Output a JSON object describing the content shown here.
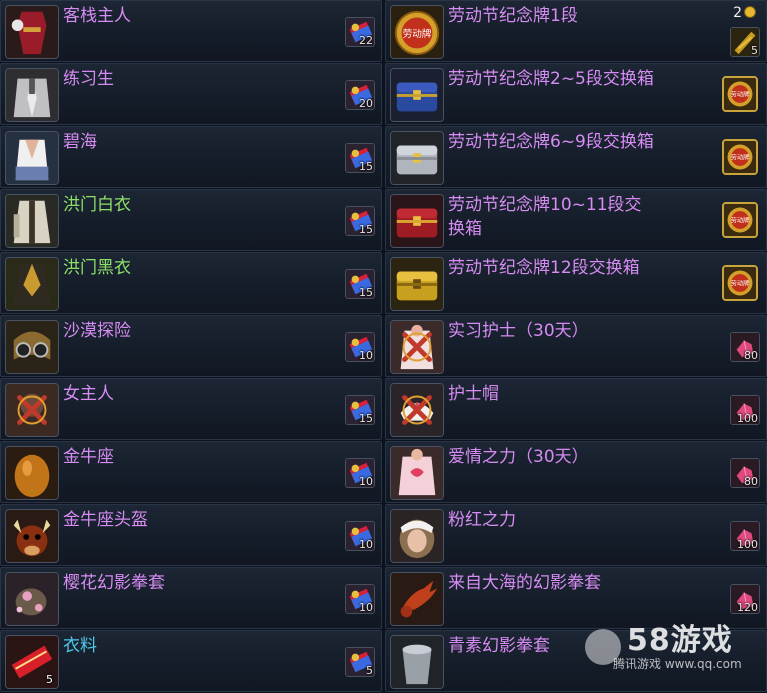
{
  "left_items": [
    {
      "name": "客栈主人",
      "price": "22",
      "name_color": "purple",
      "icon": "dress-icon"
    },
    {
      "name": "练习生",
      "price": "20",
      "name_color": "purple",
      "icon": "suit-icon"
    },
    {
      "name": "碧海",
      "price": "15",
      "name_color": "purple",
      "icon": "vest-icon"
    },
    {
      "name": "洪门白衣",
      "price": "15",
      "name_color": "green",
      "icon": "robe-icon"
    },
    {
      "name": "洪门黑衣",
      "price": "15",
      "name_color": "green",
      "icon": "robe-dark-icon"
    },
    {
      "name": "沙漠探险",
      "price": "10",
      "name_color": "purple",
      "icon": "goggles-icon"
    },
    {
      "name": "女主人",
      "price": "15",
      "name_color": "purple",
      "icon": "hidden-x-icon"
    },
    {
      "name": "金牛座",
      "price": "10",
      "name_color": "purple",
      "icon": "egg-icon"
    },
    {
      "name": "金牛座头盔",
      "price": "10",
      "name_color": "purple",
      "icon": "bull-helmet-icon"
    },
    {
      "name": "樱花幻影拳套",
      "price": "10",
      "name_color": "purple",
      "icon": "flower-glove-icon"
    },
    {
      "name": "衣料",
      "price": "5",
      "name_color": "cyan",
      "icon": "fabric-icon",
      "quantity": "5"
    }
  ],
  "right_items": [
    {
      "name": "劳动节纪念牌1段",
      "icon": "medal-icon",
      "icon_text": "劳动牌",
      "price_type": "corner",
      "count": "2",
      "price": "5"
    },
    {
      "name": "劳动节纪念牌2~5段交换箱",
      "icon": "chest-blue-icon",
      "price_type": "medal"
    },
    {
      "name": "劳动节纪念牌6~9段交换箱",
      "icon": "chest-silver-icon",
      "price_type": "medal"
    },
    {
      "name": "劳动节纪念牌10~11段交换箱",
      "icon": "chest-red-icon",
      "price_type": "medal"
    },
    {
      "name": "劳动节纪念牌12段交换箱",
      "icon": "chest-gold-icon",
      "price_type": "medal"
    },
    {
      "name": "实习护士（30天）",
      "icon": "nurse-x-icon",
      "price_type": "crystal",
      "price": "80"
    },
    {
      "name": "护士帽",
      "icon": "nurse-cap-icon",
      "price_type": "crystal",
      "price": "100"
    },
    {
      "name": "爱情之力（30天）",
      "icon": "love-shirt-icon",
      "price_type": "crystal",
      "price": "80"
    },
    {
      "name": "粉红之力",
      "icon": "pink-hair-icon",
      "price_type": "crystal",
      "price": "100"
    },
    {
      "name": "来自大海的幻影拳套",
      "icon": "lobster-glove-icon",
      "price_type": "crystal",
      "price": "120"
    },
    {
      "name": "青素幻影拳套",
      "icon": "bucket-glove-icon",
      "price_type": "none"
    }
  ],
  "watermark": {
    "title": "58游戏",
    "subtitle": "腾讯游戏 www.qq.com"
  },
  "colors": {
    "purple": "#d68cf2",
    "green": "#8de06a",
    "cyan": "#4ec9ea",
    "background": "#0b1220"
  }
}
